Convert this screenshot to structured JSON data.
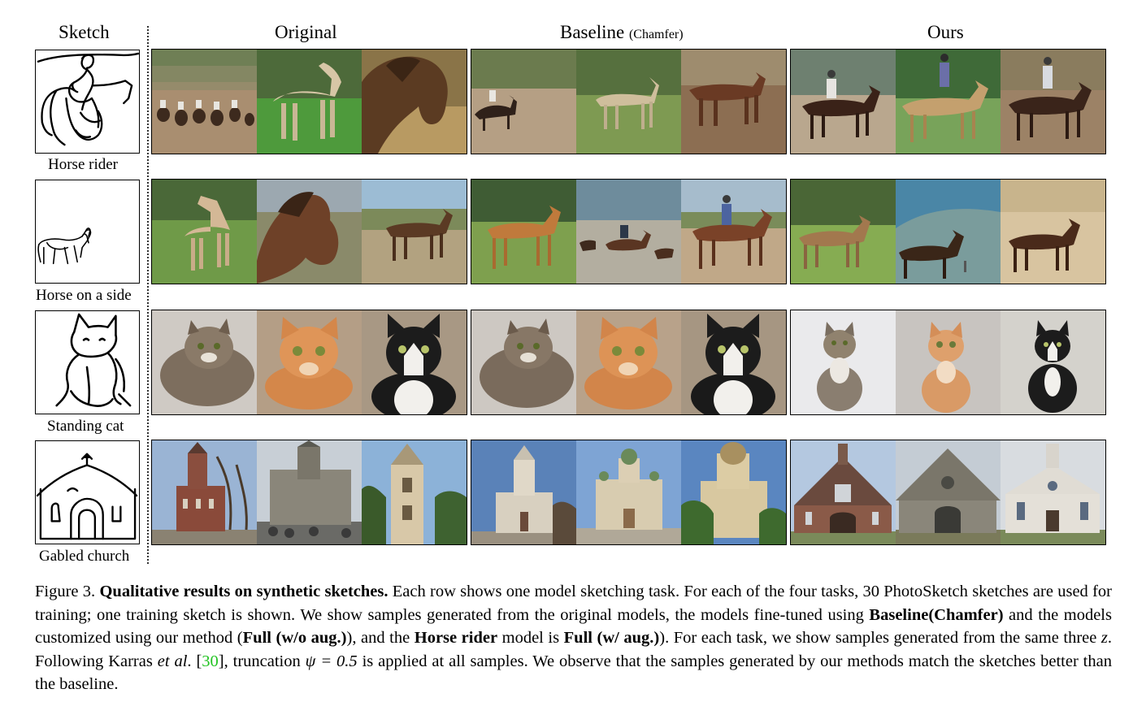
{
  "headers": {
    "sketch": "Sketch",
    "original": "Original",
    "baseline": "Baseline",
    "baseline_sub": "(Chamfer)",
    "ours": "Ours"
  },
  "rows": [
    {
      "label": "Horse rider",
      "sketch_icon": "horse-rider-sketch"
    },
    {
      "label": "Horse on a side",
      "sketch_icon": "horse-side-sketch"
    },
    {
      "label": "Standing cat",
      "sketch_icon": "standing-cat-sketch"
    },
    {
      "label": "Gabled church",
      "sketch_icon": "gabled-church-sketch"
    }
  ],
  "caption": {
    "figure_label": "Figure 3.",
    "title": "Qualitative results on synthetic sketches.",
    "t1": " Each row shows one model sketching task. For each of the four tasks, 30 PhotoSketch sketches are used for training; one training sketch is shown. We show samples generated from the original models, the models fine-tuned using ",
    "b1": "Baseline(Chamfer)",
    "t2": " and the models customized using our method (",
    "b2": "Full (w/o aug.)",
    "t3": "), and the ",
    "b3": "Horse rider",
    "t4": " model is ",
    "b4": "Full (w/ aug.)",
    "t5": "). For each task, we show samples generated from the same three ",
    "z": "z",
    "t6": ". Following Karras ",
    "etal": "et al",
    "t7": ". [",
    "cite": "30",
    "t8": "], truncation ",
    "psi": "ψ = 0.5",
    "t9": " is applied at all samples. We observe that the samples generated by our methods match the sketches better than the baseline."
  },
  "colors": {
    "citation": "#22c322"
  }
}
